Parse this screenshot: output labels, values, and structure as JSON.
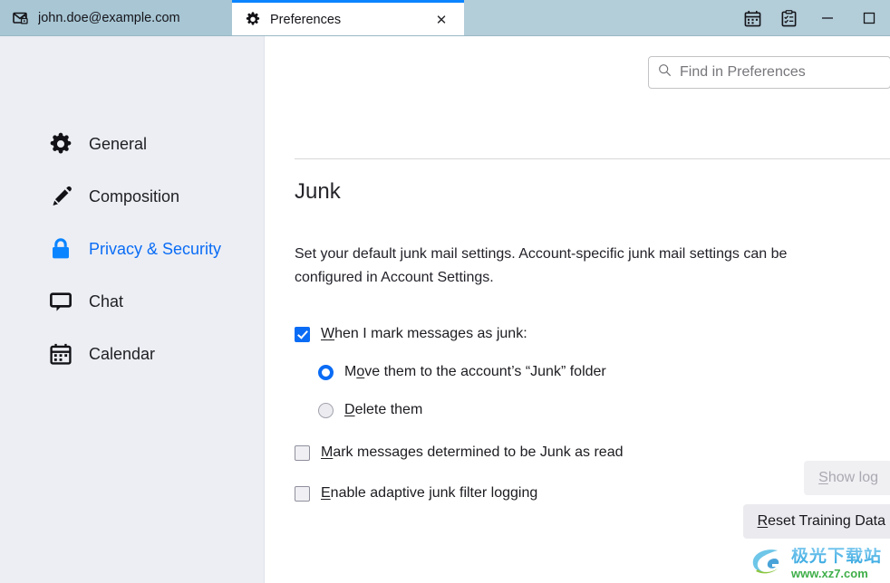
{
  "window": {
    "tabs": [
      {
        "icon": "mail-lock-icon",
        "label": "john.doe@example.com",
        "active": false
      },
      {
        "icon": "gear-icon",
        "label": "Preferences",
        "active": true,
        "close_label": "✕"
      }
    ],
    "toolbar_buttons": [
      {
        "name": "calendar-icon",
        "tooltip": "Calendar"
      },
      {
        "name": "tasks-icon",
        "tooltip": "Tasks"
      }
    ],
    "controls": {
      "minimize": "—",
      "maximize": "□"
    }
  },
  "search": {
    "placeholder": "Find in Preferences",
    "value": "",
    "icon": "search-icon"
  },
  "sidebar": {
    "items": [
      {
        "label": "General",
        "icon": "gear-icon",
        "selected": false
      },
      {
        "label": "Composition",
        "icon": "pencil-icon",
        "selected": false
      },
      {
        "label": "Privacy & Security",
        "icon": "lock-icon",
        "selected": true
      },
      {
        "label": "Chat",
        "icon": "chat-bubble-icon",
        "selected": false
      },
      {
        "label": "Calendar",
        "icon": "calendar-icon",
        "selected": false
      }
    ]
  },
  "main": {
    "section_title": "Junk",
    "description": "Set your default junk mail settings. Account-specific junk mail settings can be configured in Account Settings.",
    "options": {
      "mark_as_junk": {
        "label_pre": "",
        "accesskey": "W",
        "label_post": "hen I mark messages as junk:",
        "checked": true
      },
      "move_to_junk": {
        "label_pre": "M",
        "accesskey": "o",
        "label_post": "ve them to the account’s “Junk” folder",
        "selected": true
      },
      "delete_them": {
        "label_pre": "",
        "accesskey": "D",
        "label_post": "elete them",
        "selected": false
      },
      "mark_as_read": {
        "label_pre": "",
        "accesskey": "M",
        "label_post": "ark messages determined to be Junk as read",
        "checked": false
      },
      "adaptive_logging": {
        "label_pre": "",
        "accesskey": "E",
        "label_post": "nable adaptive junk filter logging",
        "checked": false
      }
    },
    "buttons": {
      "show_log": {
        "label_pre": "",
        "accesskey": "S",
        "label_post": "how log",
        "disabled": true
      },
      "reset_training_data": {
        "label_pre": "",
        "accesskey": "R",
        "label_post": "eset Training Data",
        "disabled": false
      }
    }
  },
  "watermark": {
    "cn": "极光下载站",
    "url": "www.xz7.com"
  },
  "colors": {
    "accent": "#0a6cf5",
    "titlebar": "#b3cdd9",
    "tab_active_border": "#0a84ff",
    "sidebar_bg": "#eceef4"
  }
}
